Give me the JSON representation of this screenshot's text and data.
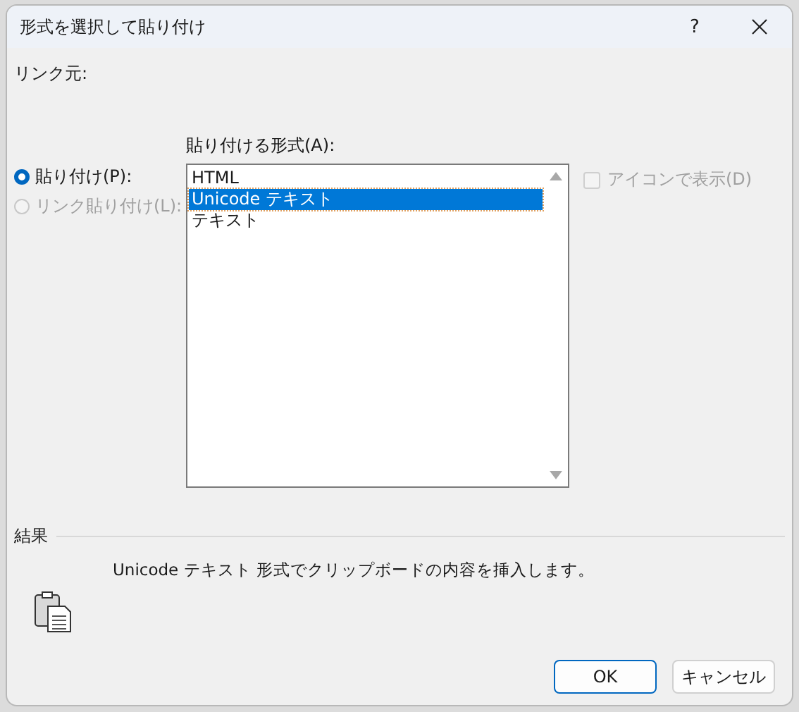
{
  "window": {
    "title": "形式を選択して貼り付け",
    "help": "?"
  },
  "source_label": "リンク元:",
  "options": [
    {
      "label": "貼り付け(P):",
      "selected": true,
      "disabled": false
    },
    {
      "label": "リンク貼り付け(L):",
      "selected": false,
      "disabled": true
    }
  ],
  "format_list": {
    "label": "貼り付ける形式(A):",
    "items": [
      {
        "label": "HTML",
        "selected": false
      },
      {
        "label": "Unicode テキスト",
        "selected": true
      },
      {
        "label": "テキスト",
        "selected": false
      }
    ]
  },
  "display_as_icon": {
    "label": "アイコンで表示(D)",
    "checked": false,
    "disabled": true
  },
  "result": {
    "heading": "結果",
    "description": "Unicode テキスト 形式でクリップボードの内容を挿入します。"
  },
  "buttons": [
    {
      "label": "OK",
      "default": true
    },
    {
      "label": "キャンセル",
      "default": false
    }
  ]
}
